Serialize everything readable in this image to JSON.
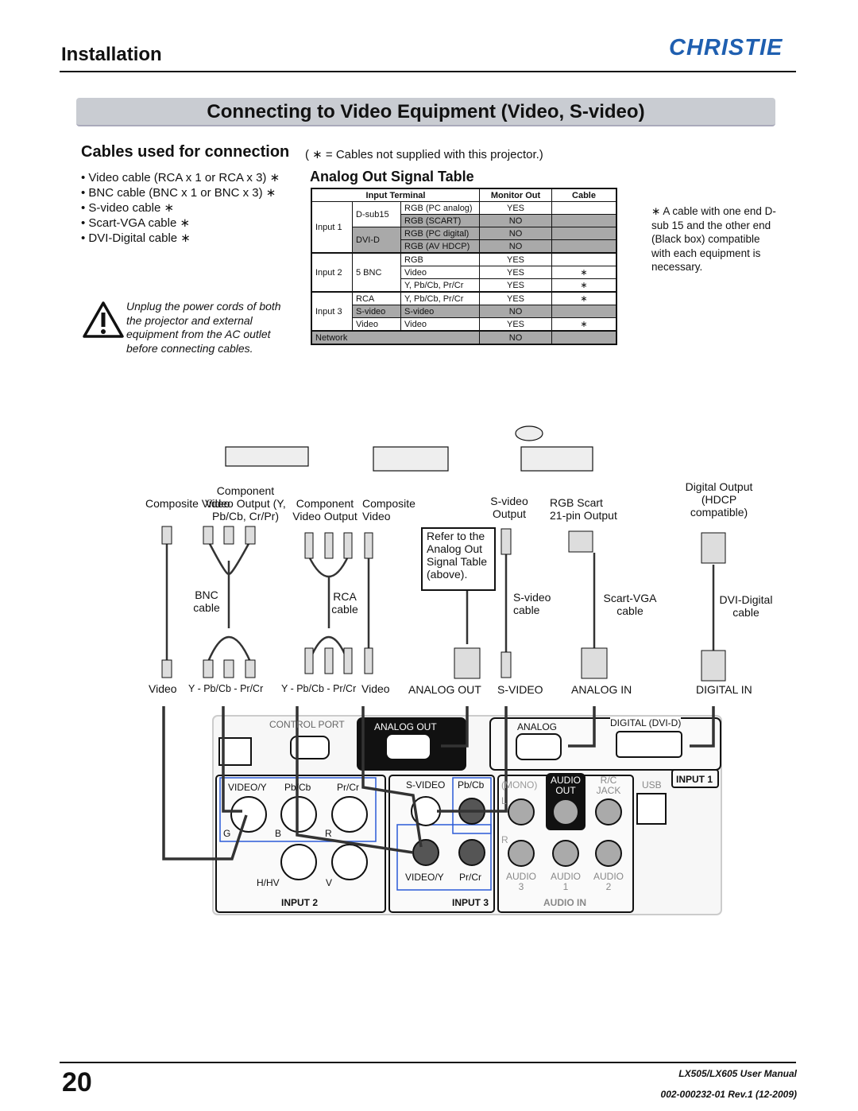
{
  "header": {
    "section": "Installation",
    "brand": "CHRISTIE"
  },
  "banner": {
    "title": "Connecting to Video Equipment (Video, S-video)"
  },
  "cables": {
    "heading": "Cables used for connection",
    "note": "( ∗ = Cables not supplied with this projector.)",
    "items": [
      "• Video cable (RCA x 1 or RCA x 3) ∗",
      "• BNC cable (BNC x 1 or BNC x 3) ∗",
      "• S-video cable ∗",
      "• Scart-VGA cable ∗",
      "• DVI-Digital cable ∗"
    ]
  },
  "warning": "Unplug the power cords of both the projector and external equipment from the AC outlet before connecting cables.",
  "table": {
    "title": "Analog Out Signal Table",
    "headers": [
      "Input Terminal",
      "Monitor Out",
      "Cable"
    ],
    "groups": [
      "Input 1",
      "Input 2",
      "Input 3",
      "Network"
    ],
    "terminals": [
      "D-sub15",
      "DVI-D",
      "5 BNC",
      "RCA",
      "S-video",
      "Video"
    ],
    "rows": [
      {
        "signal": "RGB (PC analog)",
        "monitor": "YES",
        "cable": ""
      },
      {
        "signal": "RGB (SCART)",
        "monitor": "NO",
        "cable": ""
      },
      {
        "signal": "RGB (PC digital)",
        "monitor": "NO",
        "cable": ""
      },
      {
        "signal": "RGB (AV HDCP)",
        "monitor": "NO",
        "cable": ""
      },
      {
        "signal": "RGB",
        "monitor": "YES",
        "cable": ""
      },
      {
        "signal": "Video",
        "monitor": "YES",
        "cable": "∗"
      },
      {
        "signal": "Y, Pb/Cb, Pr/Cr",
        "monitor": "YES",
        "cable": "∗"
      },
      {
        "signal": "Y, Pb/Cb, Pr/Cr",
        "monitor": "YES",
        "cable": "∗"
      },
      {
        "signal": "S-video",
        "monitor": "NO",
        "cable": ""
      },
      {
        "signal": "Video",
        "monitor": "YES",
        "cable": "∗"
      },
      {
        "signal": "",
        "monitor": "NO",
        "cable": ""
      }
    ]
  },
  "side_note": "∗  A cable with one end D-sub 15 and the other end (Black box) compatible with each equipment is necessary.",
  "diagram": {
    "sources": {
      "composite_video": "Composite Video",
      "component_video_output": "Component Video  Output (Y, Pb/Cb, Cr/Pr)",
      "component_video_output2": "Component Video Output",
      "composite_video2": "Composite Video",
      "svideo_output": "S-video Output",
      "rgb_scart": "RGB Scart 21-pin Output",
      "digital_output": "Digital Output (HDCP compatible)"
    },
    "refer_box": "Refer to the Analog Out Signal Table (above).",
    "cables": {
      "bnc": "BNC cable",
      "rca": "RCA cable",
      "svideo": "S-video cable",
      "scart_vga": "Scart-VGA cable",
      "dvi": "DVI-Digital cable"
    },
    "plugs": {
      "video1": "Video",
      "ypbpr1": "Y - Pb/Cb - Pr/Cr",
      "ypbpr2": "Y - Pb/Cb - Pr/Cr",
      "video2": "Video",
      "analog_out": "ANALOG OUT",
      "svideo": "S-VIDEO",
      "analog_in": "ANALOG IN",
      "digital_in": "DIGITAL IN"
    },
    "panel": {
      "control_port": "CONTROL PORT",
      "analog_out": "ANALOG OUT",
      "analog": "ANALOG",
      "digital": "DIGITAL (DVI-D)",
      "input1": "INPUT 1",
      "video_y": "VIDEO/Y",
      "pb_cb": "Pb/Cb",
      "pr_cr": "Pr/Cr",
      "g": "G",
      "b": "B",
      "r": "R",
      "h_hv": "H/HV",
      "v": "V",
      "input2": "INPUT 2",
      "s_video": "S-VIDEO",
      "pb_cb3": "Pb/Cb",
      "video_y3": "VIDEO/Y",
      "pr_cr3": "Pr/Cr",
      "input3": "INPUT 3",
      "mono": "(MONO)",
      "l": "L",
      "r3": "R",
      "audio_out": "AUDIO OUT",
      "rc_jack": "R/C JACK",
      "usb": "USB",
      "audio3": "AUDIO 3",
      "audio1": "AUDIO 1",
      "audio2": "AUDIO 2",
      "audio_in": "AUDIO IN"
    }
  },
  "footer": {
    "page": "20",
    "manual": "LX505/LX605 User Manual",
    "doc": "002-000232-01 Rev.1 (12-2009)"
  },
  "colors": {
    "brand": "#1f5fb0",
    "banner": "#c9ccd2",
    "table_gray": "#a9a9a9",
    "panel_blue": "#2a5bd7"
  }
}
